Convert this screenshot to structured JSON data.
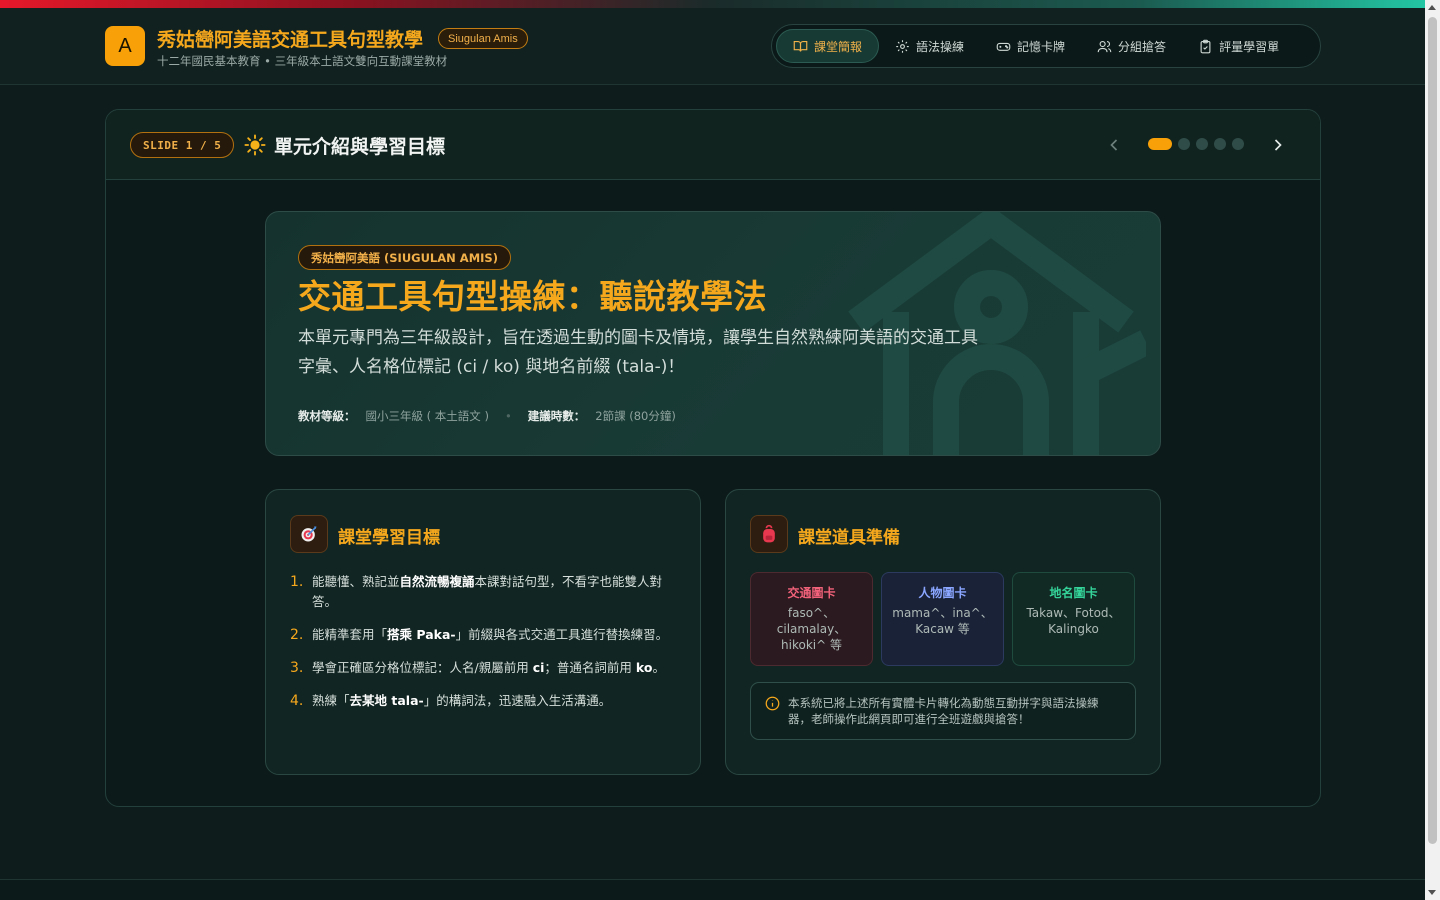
{
  "app": {
    "logo_letter": "A",
    "title": "秀姑巒阿美語交通工具句型教學",
    "badge": "Siugulan Amis",
    "subtitle": "十二年國民基本教育 • 三年級本土語文雙向互動課堂教材"
  },
  "nav": {
    "tabs": [
      {
        "label": "課堂簡報",
        "icon": "book-open-icon",
        "active": true
      },
      {
        "label": "語法操練",
        "icon": "gear-icon",
        "active": false
      },
      {
        "label": "記憶卡牌",
        "icon": "gamepad-icon",
        "active": false
      },
      {
        "label": "分組搶答",
        "icon": "users-icon",
        "active": false
      },
      {
        "label": "評量學習單",
        "icon": "clipboard-icon",
        "active": false
      }
    ]
  },
  "slide": {
    "counter": "SLIDE 1 / 5",
    "icon": "sun-icon",
    "title": "單元介紹與學習目標",
    "current_index": 1,
    "total": 5
  },
  "hero": {
    "pill": "秀姑巒阿美語 (SIUGULAN AMIS)",
    "title": "交通工具句型操練：聽說教學法",
    "desc": "本單元專門為三年級設計，旨在透過生動的圖卡及情境，讓學生自然熟練阿美語的交通工具字彙、人名格位標記 (ci / ko) 與地名前綴 (tala-)！",
    "meta_grade_label": "教材等級：",
    "meta_grade_value": "國小三年級 ( 本土語文 )",
    "meta_sep": "•",
    "meta_time_label": "建議時數：",
    "meta_time_value": "2節課 (80分鐘)",
    "bg_icon": "school-icon"
  },
  "goals_card": {
    "icon": "target-icon",
    "title": "課堂學習目標",
    "items": [
      {
        "num": "1.",
        "pre": "能聽懂、熟記並",
        "bold": "自然流暢複誦",
        "post": "本課對話句型，不看字也能雙人對答。"
      },
      {
        "num": "2.",
        "pre": "能精準套用「",
        "bold": "搭乘 Paka-",
        "post": "」前綴與各式交通工具進行替換練習。"
      },
      {
        "num": "3.",
        "pre": "學會正確區分格位標記：人名/親屬前用 ",
        "bold": "ci",
        "post": "；普通名詞前用 ",
        "bold2": "ko",
        "post2": "。"
      },
      {
        "num": "4.",
        "pre": "熟練「",
        "bold": "去某地 tala-",
        "post": "」的構詞法，迅速融入生活溝通。"
      }
    ]
  },
  "props_card": {
    "icon": "backpack-icon",
    "title": "課堂道具準備",
    "props": [
      {
        "title": "交通圖卡",
        "desc": "faso^、cilamalay、hikoki^ 等",
        "color": "#f2627a"
      },
      {
        "title": "人物圖卡",
        "desc": "mama^、ina^、Kacaw 等",
        "color": "#8aa6ff"
      },
      {
        "title": "地名圖卡",
        "desc": "Takaw、Fotod、Kalingko",
        "color": "#34d39a"
      }
    ],
    "notice_icon": "info-icon",
    "notice": "本系統已將上述所有實體卡片轉化為動態互動拼字與語法操練器，老師操作此網頁即可進行全班遊戲與搶答！"
  },
  "colors": {
    "accent": "#f6a81d",
    "background": "#0e1d1c",
    "panel": "#112522"
  }
}
